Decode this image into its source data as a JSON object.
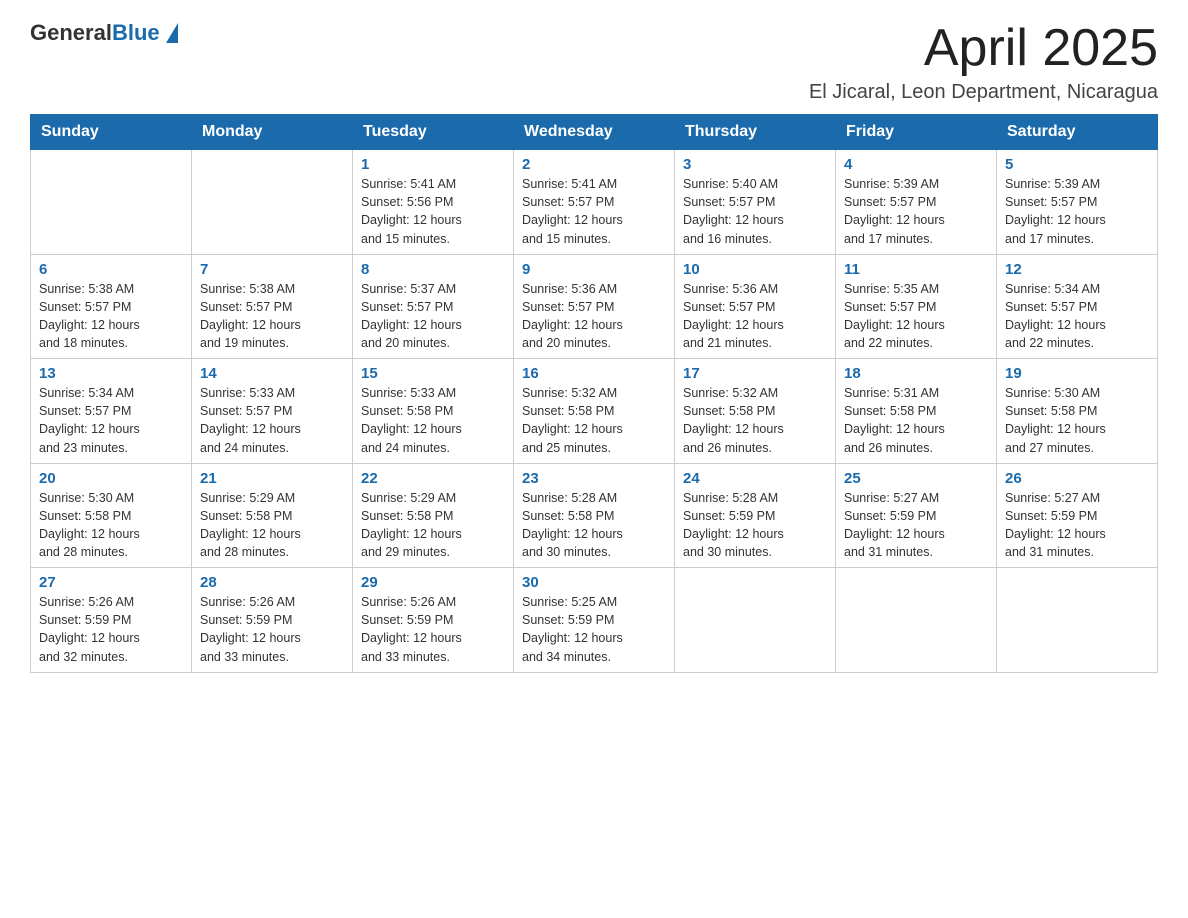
{
  "header": {
    "logo_general": "General",
    "logo_blue": "Blue",
    "title": "April 2025",
    "subtitle": "El Jicaral, Leon Department, Nicaragua"
  },
  "days_of_week": [
    "Sunday",
    "Monday",
    "Tuesday",
    "Wednesday",
    "Thursday",
    "Friday",
    "Saturday"
  ],
  "weeks": [
    [
      {
        "day": "",
        "info": ""
      },
      {
        "day": "",
        "info": ""
      },
      {
        "day": "1",
        "info": "Sunrise: 5:41 AM\nSunset: 5:56 PM\nDaylight: 12 hours\nand 15 minutes."
      },
      {
        "day": "2",
        "info": "Sunrise: 5:41 AM\nSunset: 5:57 PM\nDaylight: 12 hours\nand 15 minutes."
      },
      {
        "day": "3",
        "info": "Sunrise: 5:40 AM\nSunset: 5:57 PM\nDaylight: 12 hours\nand 16 minutes."
      },
      {
        "day": "4",
        "info": "Sunrise: 5:39 AM\nSunset: 5:57 PM\nDaylight: 12 hours\nand 17 minutes."
      },
      {
        "day": "5",
        "info": "Sunrise: 5:39 AM\nSunset: 5:57 PM\nDaylight: 12 hours\nand 17 minutes."
      }
    ],
    [
      {
        "day": "6",
        "info": "Sunrise: 5:38 AM\nSunset: 5:57 PM\nDaylight: 12 hours\nand 18 minutes."
      },
      {
        "day": "7",
        "info": "Sunrise: 5:38 AM\nSunset: 5:57 PM\nDaylight: 12 hours\nand 19 minutes."
      },
      {
        "day": "8",
        "info": "Sunrise: 5:37 AM\nSunset: 5:57 PM\nDaylight: 12 hours\nand 20 minutes."
      },
      {
        "day": "9",
        "info": "Sunrise: 5:36 AM\nSunset: 5:57 PM\nDaylight: 12 hours\nand 20 minutes."
      },
      {
        "day": "10",
        "info": "Sunrise: 5:36 AM\nSunset: 5:57 PM\nDaylight: 12 hours\nand 21 minutes."
      },
      {
        "day": "11",
        "info": "Sunrise: 5:35 AM\nSunset: 5:57 PM\nDaylight: 12 hours\nand 22 minutes."
      },
      {
        "day": "12",
        "info": "Sunrise: 5:34 AM\nSunset: 5:57 PM\nDaylight: 12 hours\nand 22 minutes."
      }
    ],
    [
      {
        "day": "13",
        "info": "Sunrise: 5:34 AM\nSunset: 5:57 PM\nDaylight: 12 hours\nand 23 minutes."
      },
      {
        "day": "14",
        "info": "Sunrise: 5:33 AM\nSunset: 5:57 PM\nDaylight: 12 hours\nand 24 minutes."
      },
      {
        "day": "15",
        "info": "Sunrise: 5:33 AM\nSunset: 5:58 PM\nDaylight: 12 hours\nand 24 minutes."
      },
      {
        "day": "16",
        "info": "Sunrise: 5:32 AM\nSunset: 5:58 PM\nDaylight: 12 hours\nand 25 minutes."
      },
      {
        "day": "17",
        "info": "Sunrise: 5:32 AM\nSunset: 5:58 PM\nDaylight: 12 hours\nand 26 minutes."
      },
      {
        "day": "18",
        "info": "Sunrise: 5:31 AM\nSunset: 5:58 PM\nDaylight: 12 hours\nand 26 minutes."
      },
      {
        "day": "19",
        "info": "Sunrise: 5:30 AM\nSunset: 5:58 PM\nDaylight: 12 hours\nand 27 minutes."
      }
    ],
    [
      {
        "day": "20",
        "info": "Sunrise: 5:30 AM\nSunset: 5:58 PM\nDaylight: 12 hours\nand 28 minutes."
      },
      {
        "day": "21",
        "info": "Sunrise: 5:29 AM\nSunset: 5:58 PM\nDaylight: 12 hours\nand 28 minutes."
      },
      {
        "day": "22",
        "info": "Sunrise: 5:29 AM\nSunset: 5:58 PM\nDaylight: 12 hours\nand 29 minutes."
      },
      {
        "day": "23",
        "info": "Sunrise: 5:28 AM\nSunset: 5:58 PM\nDaylight: 12 hours\nand 30 minutes."
      },
      {
        "day": "24",
        "info": "Sunrise: 5:28 AM\nSunset: 5:59 PM\nDaylight: 12 hours\nand 30 minutes."
      },
      {
        "day": "25",
        "info": "Sunrise: 5:27 AM\nSunset: 5:59 PM\nDaylight: 12 hours\nand 31 minutes."
      },
      {
        "day": "26",
        "info": "Sunrise: 5:27 AM\nSunset: 5:59 PM\nDaylight: 12 hours\nand 31 minutes."
      }
    ],
    [
      {
        "day": "27",
        "info": "Sunrise: 5:26 AM\nSunset: 5:59 PM\nDaylight: 12 hours\nand 32 minutes."
      },
      {
        "day": "28",
        "info": "Sunrise: 5:26 AM\nSunset: 5:59 PM\nDaylight: 12 hours\nand 33 minutes."
      },
      {
        "day": "29",
        "info": "Sunrise: 5:26 AM\nSunset: 5:59 PM\nDaylight: 12 hours\nand 33 minutes."
      },
      {
        "day": "30",
        "info": "Sunrise: 5:25 AM\nSunset: 5:59 PM\nDaylight: 12 hours\nand 34 minutes."
      },
      {
        "day": "",
        "info": ""
      },
      {
        "day": "",
        "info": ""
      },
      {
        "day": "",
        "info": ""
      }
    ]
  ]
}
